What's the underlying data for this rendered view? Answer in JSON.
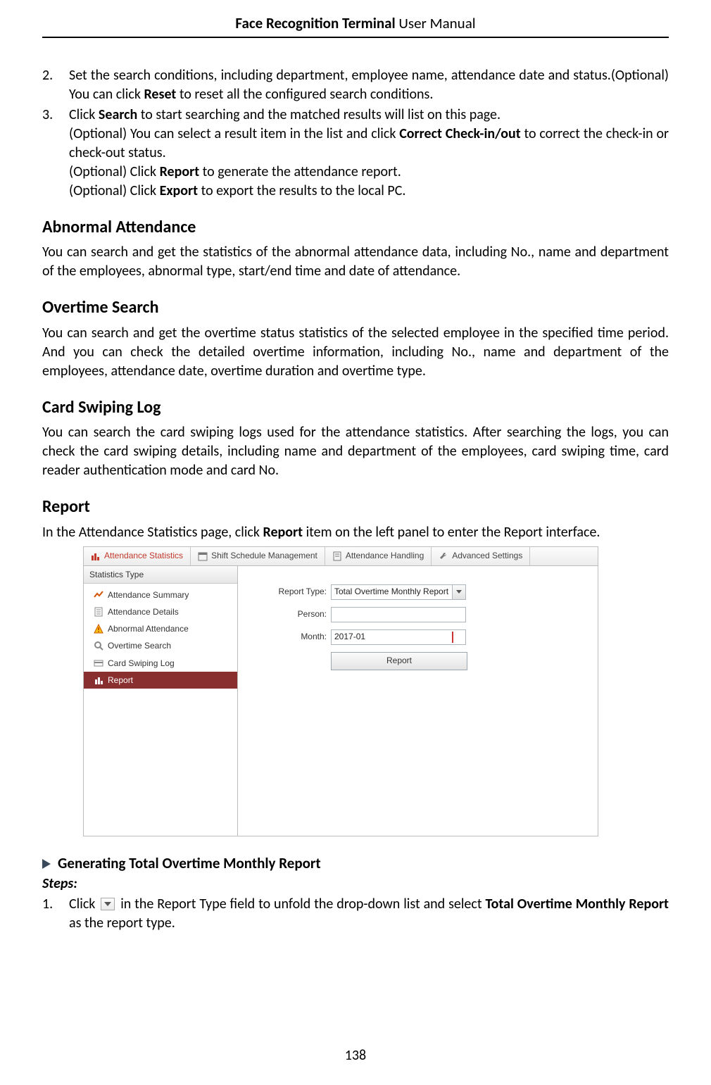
{
  "header": {
    "bold": "Face Recognition Terminal",
    "rest": "  User Manual"
  },
  "list_top": [
    {
      "num": "2.",
      "parts": [
        "Set the search conditions, including department, employee name, attendance date and status.",
        "(Optional) You can click ",
        {
          "b": "Reset"
        },
        " to reset all the configured search conditions."
      ]
    },
    {
      "num": "3.",
      "parts": [
        "Click ",
        {
          "b": "Search"
        },
        " to start searching and the matched results will list on this page.",
        {
          "br": true
        },
        "(Optional) You can select a result item in the list and click ",
        {
          "b": "Correct Check-in/out"
        },
        " to correct the check-in or check-out status.",
        {
          "br": true
        },
        "(Optional) Click ",
        {
          "b": "Report"
        },
        " to generate the attendance report.",
        {
          "br": true
        },
        "(Optional) Click ",
        {
          "b": "Export"
        },
        " to export the results to the local PC."
      ]
    }
  ],
  "sections": [
    {
      "title": "Abnormal Attendance",
      "body": "You can search and get the statistics of the abnormal attendance data, including No., name and department of the employees, abnormal type, start/end time and date of attendance."
    },
    {
      "title": "Overtime Search",
      "body": "You can search and get the overtime status statistics of the selected employee in the specified time period. And you can check the detailed overtime information, including No., name and department of the employees, attendance date, overtime duration and overtime type."
    },
    {
      "title": "Card Swiping Log",
      "body": "You can search the card swiping logs used for the attendance statistics. After searching the logs, you can check the card swiping details, including name and department of the employees, card swiping time, card reader authentication mode and card No."
    },
    {
      "title": "Report",
      "body_parts": [
        "In the Attendance Statistics page, click ",
        {
          "b": "Report"
        },
        " item on the left panel to enter the Report interface."
      ]
    }
  ],
  "screenshot": {
    "tabs": [
      {
        "label": "Attendance Statistics",
        "active": true
      },
      {
        "label": "Shift Schedule Management"
      },
      {
        "label": "Attendance Handling"
      },
      {
        "label": "Advanced Settings"
      }
    ],
    "sidebar": {
      "title": "Statistics Type",
      "items": [
        {
          "label": "Attendance Summary"
        },
        {
          "label": "Attendance Details"
        },
        {
          "label": "Abnormal Attendance"
        },
        {
          "label": "Overtime Search"
        },
        {
          "label": "Card Swiping Log"
        },
        {
          "label": "Report",
          "selected": true
        }
      ]
    },
    "form": {
      "report_type_label": "Report Type:",
      "report_type_value": "Total Overtime Monthly Report",
      "person_label": "Person:",
      "person_value": "",
      "month_label": "Month:",
      "month_value": "2017-01",
      "button": "Report"
    }
  },
  "sub_heading": "Generating Total Overtime Monthly Report",
  "steps_label": "Steps:",
  "step1": {
    "num": "1.",
    "parts": [
      "Click ",
      {
        "icon": "dropdown"
      },
      " in the Report Type field to unfold the drop-down list and select ",
      {
        "b": "Total Overtime Monthly Report"
      },
      " as the report type."
    ]
  },
  "page_number": "138"
}
